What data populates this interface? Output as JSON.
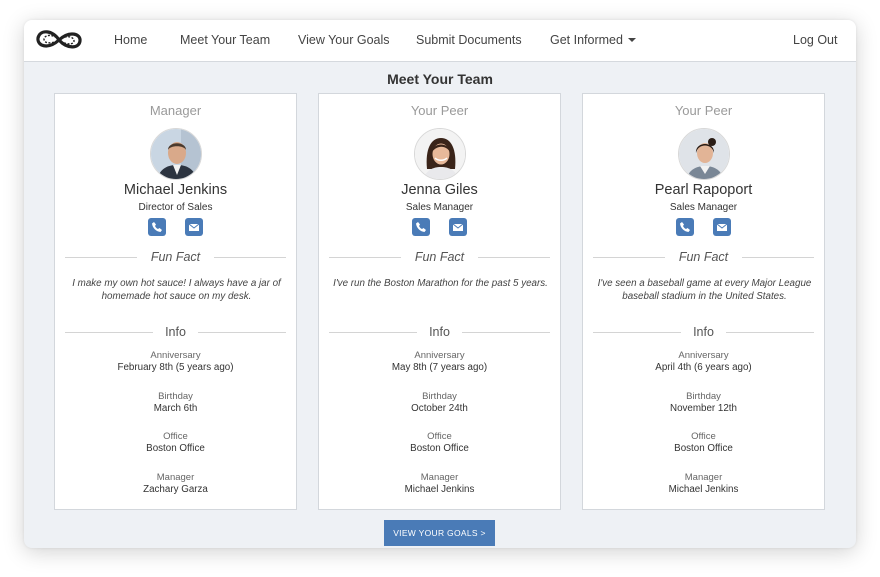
{
  "nav": {
    "items": [
      "Home",
      "Meet Your Team",
      "View Your Goals",
      "Submit Documents"
    ],
    "dropdown_label": "Get Informed",
    "logout_label": "Log Out"
  },
  "page_title": "Meet Your Team",
  "section_labels": {
    "fun_fact": "Fun Fact",
    "info": "Info"
  },
  "info_keys": {
    "anniversary": "Anniversary",
    "birthday": "Birthday",
    "office": "Office",
    "manager": "Manager"
  },
  "cards": [
    {
      "role": "Manager",
      "name": "Michael Jenkins",
      "title": "Director of Sales",
      "fun_fact": "I make my own hot sauce! I always have a jar of homemade hot sauce on my desk.",
      "anniversary": "February 8th (5 years ago)",
      "birthday": "March 6th",
      "office": "Boston Office",
      "manager": "Zachary Garza"
    },
    {
      "role": "Your Peer",
      "name": "Jenna Giles",
      "title": "Sales Manager",
      "fun_fact": "I've run the Boston Marathon for the past 5 years.",
      "anniversary": "May 8th (7 years ago)",
      "birthday": "October 24th",
      "office": "Boston Office",
      "manager": "Michael Jenkins"
    },
    {
      "role": "Your Peer",
      "name": "Pearl Rapoport",
      "title": "Sales Manager",
      "fun_fact": "I've seen a baseball game at every Major League baseball stadium in the United States.",
      "anniversary": "April 4th (6 years ago)",
      "birthday": "November 12th",
      "office": "Boston Office",
      "manager": "Michael Jenkins"
    }
  ],
  "cta_label": "VIEW YOUR GOALS >",
  "colors": {
    "accent": "#4a7bb7",
    "background": "#eef1f5"
  }
}
